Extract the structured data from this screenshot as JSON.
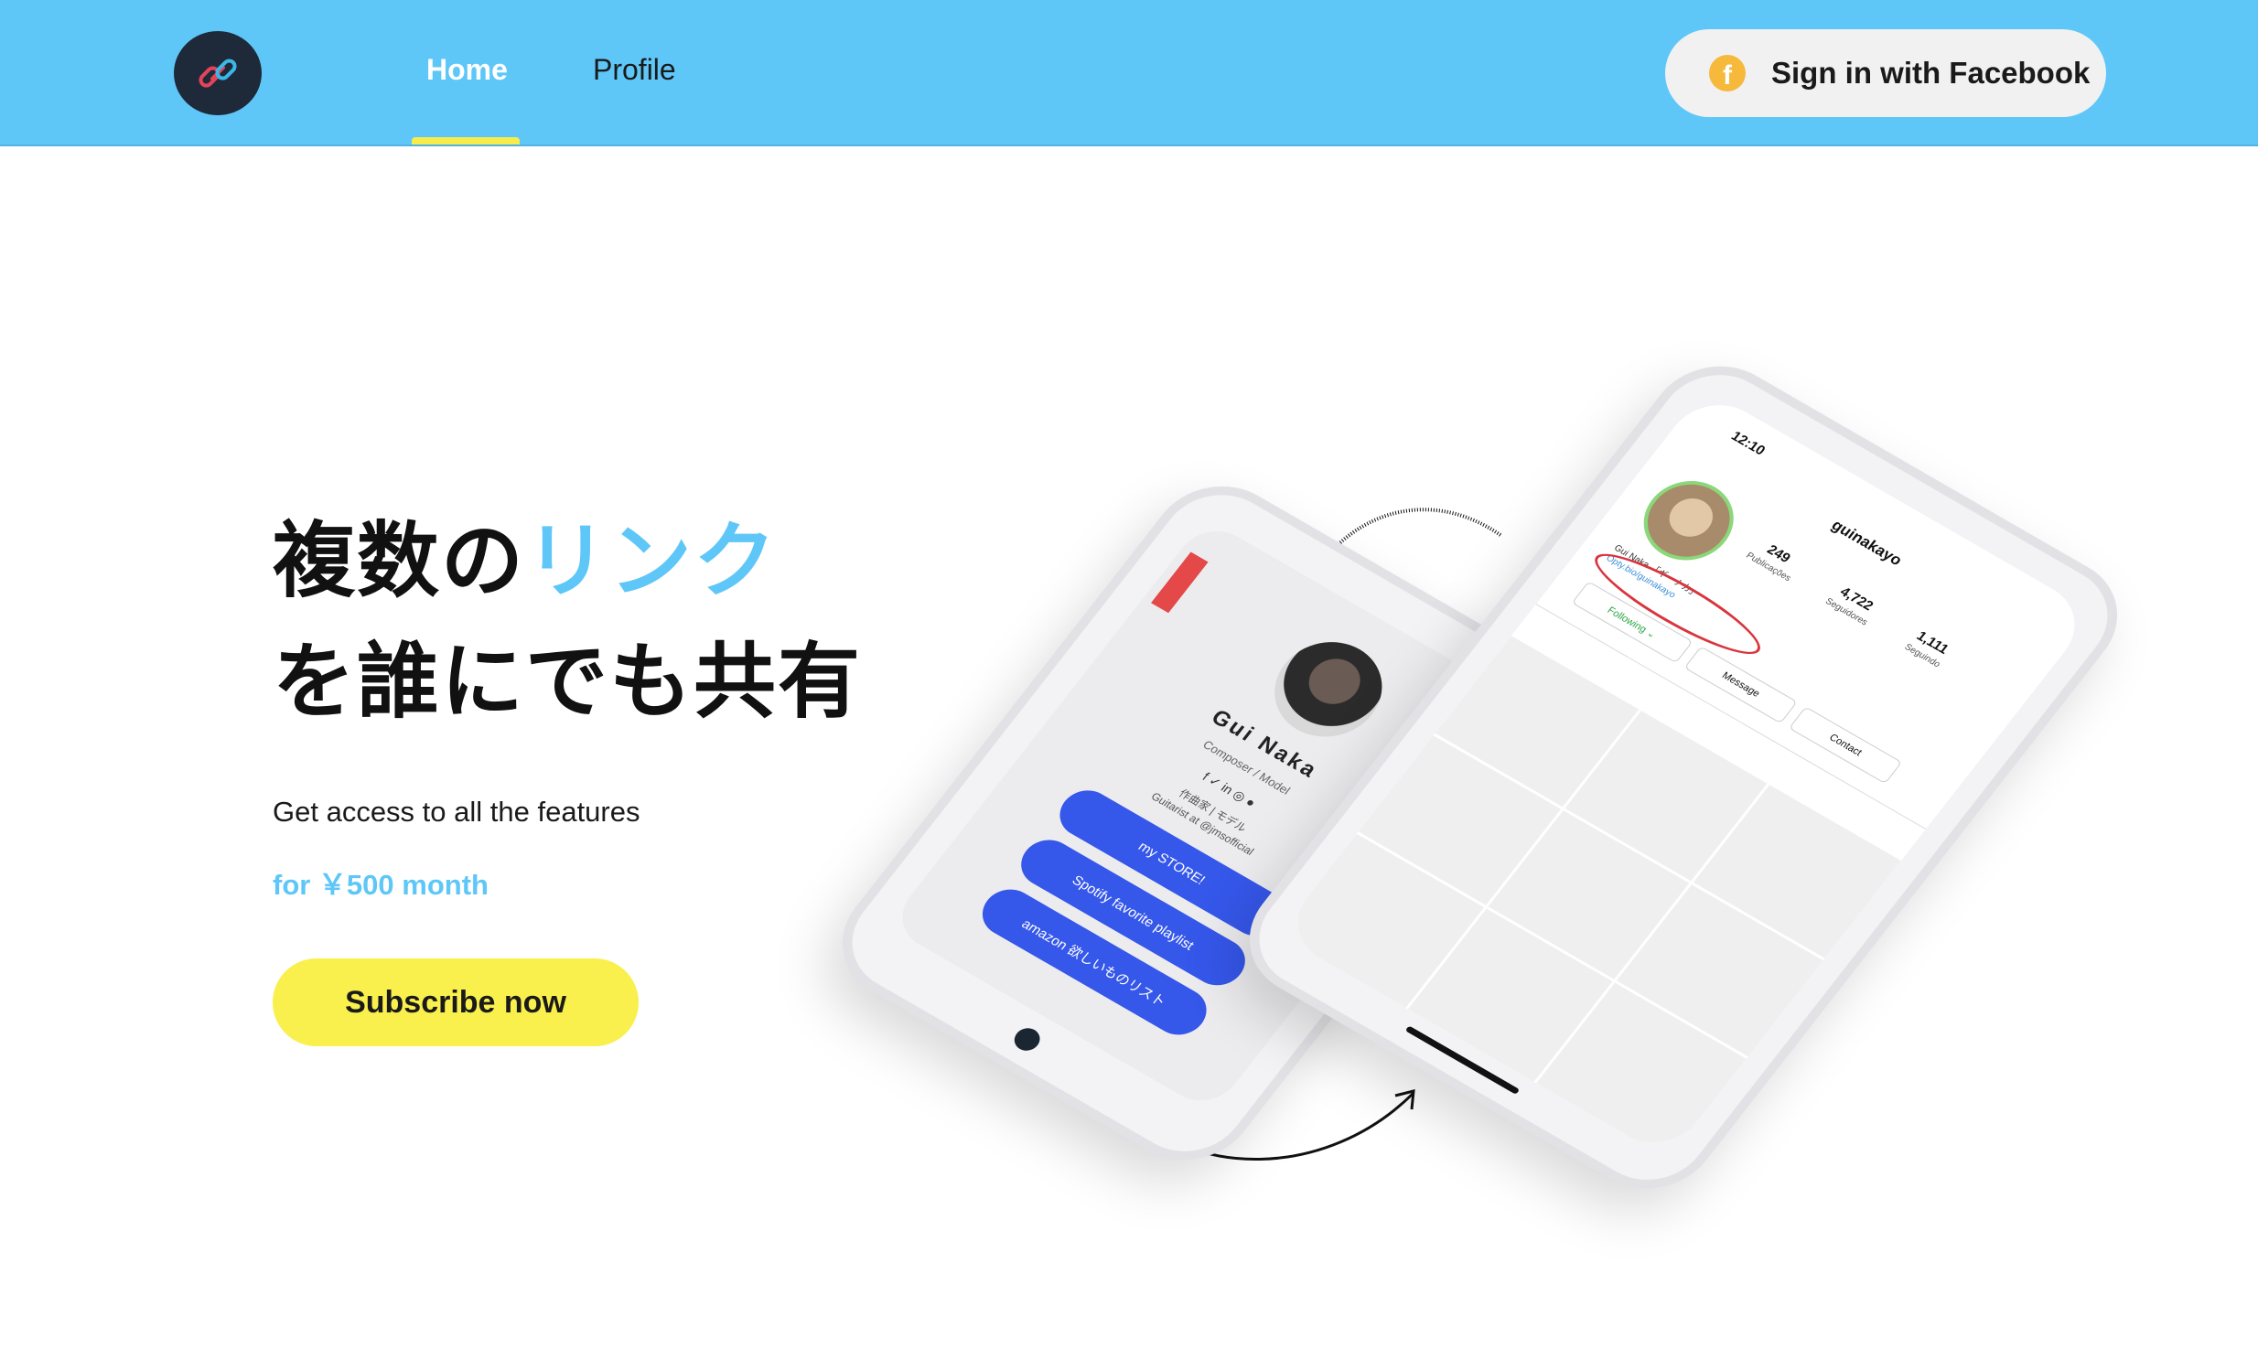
{
  "nav": {
    "home_label": "Home",
    "profile_label": "Profile",
    "signin_label": "Sign in with Facebook",
    "facebook_icon_glyph": "f"
  },
  "hero": {
    "headline_part1": "複数の",
    "headline_accent": "リンク",
    "headline_line2": "を誰にでも共有",
    "subtitle": "Get access to all the features",
    "price": "for ￥500 month",
    "cta_label": "Subscribe now"
  },
  "phone_left": {
    "name": "Gui Naka",
    "role": "Composer / Model",
    "social_icons": "f  ✓  in  ◎  ●",
    "bio_line1": "作曲家 | モデル",
    "bio_line2": "Guitarist at @jmsofficial",
    "links": [
      "my STORE!",
      "Spotify favorite playlist",
      "amazon 欲しいものリスト"
    ]
  },
  "phone_right": {
    "time": "12:10",
    "username": "guinakayo",
    "posts_count": "249",
    "posts_label": "Publicações",
    "followers_count": "4,722",
    "followers_label": "Seguidores",
    "following_count": "1,111",
    "following_label": "Seguindo",
    "bio": "Gui Naka 「ギーナカ」",
    "bio_link": "Opty.bio/guinakayo",
    "following_button": "Following ⌄",
    "message_button": "Message",
    "contact_button": "Contact"
  },
  "colors": {
    "header_bg": "#5ec7f8",
    "accent_blue": "#5ec7f8",
    "nav_underline": "#f7ec4a",
    "cta_yellow": "#f9ef4d",
    "link_button_blue": "#3557ea",
    "facebook_icon": "#f6b93b"
  },
  "icons": {
    "logo": "chain-link-icon",
    "facebook": "facebook-icon"
  }
}
